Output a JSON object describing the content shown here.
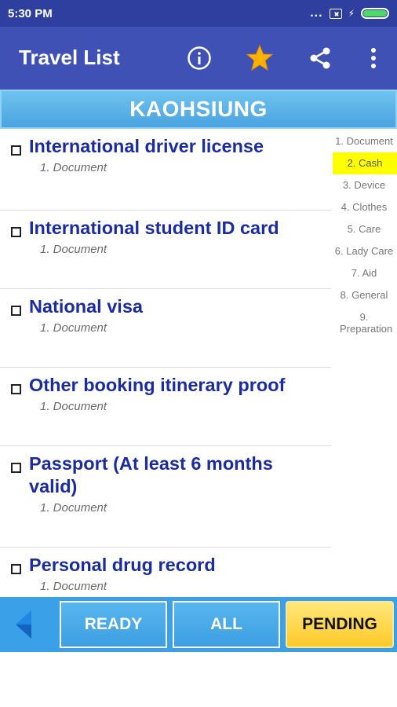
{
  "status_bar": {
    "time": "5:30 PM",
    "dots": "..."
  },
  "app_bar": {
    "title": "Travel List"
  },
  "header": {
    "title": "KAOHSIUNG"
  },
  "items": [
    {
      "title": "International driver license",
      "category": "1. Document"
    },
    {
      "title": "International student ID card",
      "category": "1. Document"
    },
    {
      "title": "National visa",
      "category": "1. Document"
    },
    {
      "title": "Other booking itinerary proof",
      "category": "1. Document"
    },
    {
      "title": "Passport (At least 6 months valid)",
      "category": "1. Document"
    },
    {
      "title": "Personal drug record",
      "category": "1. Document"
    }
  ],
  "categories": [
    {
      "label": "1. Document"
    },
    {
      "label": "2. Cash",
      "active": true
    },
    {
      "label": "3. Device"
    },
    {
      "label": "4. Clothes"
    },
    {
      "label": "5. Care"
    },
    {
      "label": "6. Lady Care"
    },
    {
      "label": "7. Aid"
    },
    {
      "label": "8. General"
    },
    {
      "label": "9. Preparation"
    }
  ],
  "bottom_tabs": {
    "ready": "READY",
    "all": "ALL",
    "pending": "PENDING"
  },
  "colors": {
    "status_bar": "#2f3f9f",
    "app_bar": "#3f51b5",
    "item_title": "#1a2ca0",
    "highlight": "#ffff00",
    "pending": "#ffc928",
    "star": "#ffb300"
  },
  "icons": {
    "info": "info-icon",
    "star": "star-icon",
    "share": "share-icon",
    "more": "more-vert-icon",
    "back": "back-arrow-icon"
  }
}
